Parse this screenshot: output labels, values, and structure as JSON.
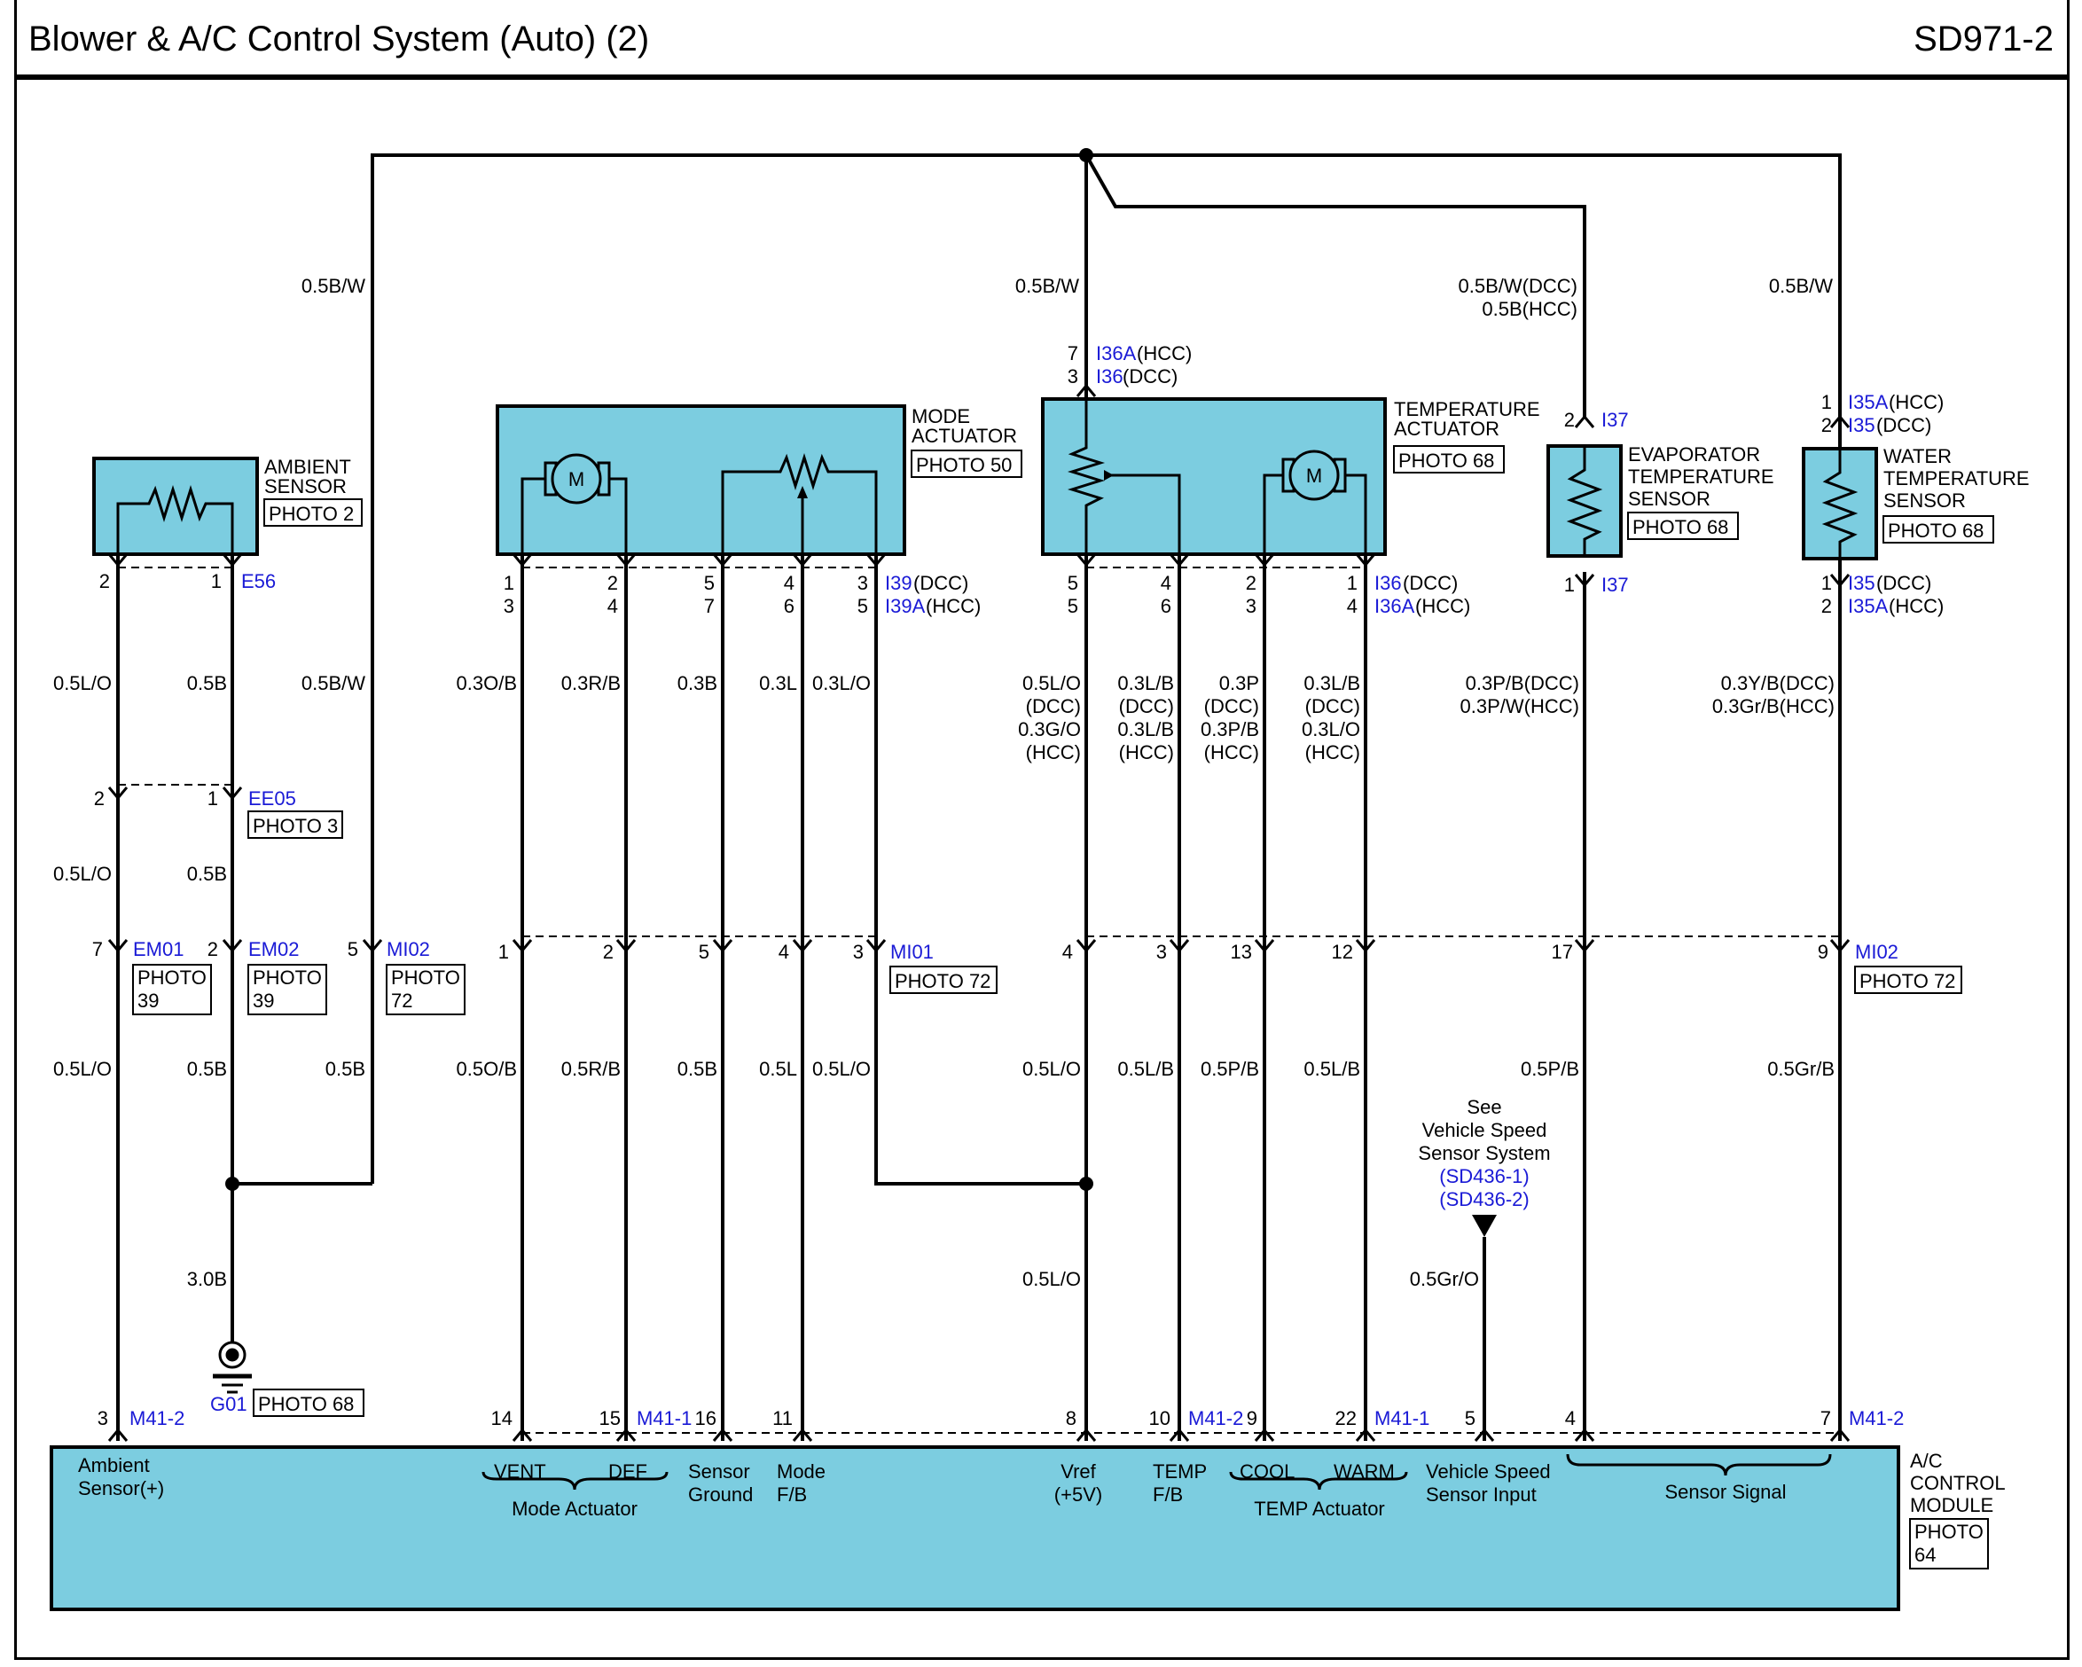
{
  "header": {
    "title": "Blower & A/C Control System (Auto) (2)",
    "code": "SD971-2"
  },
  "colors": {
    "component_fill": "#7ccde0",
    "connector_text": "#1a1ad6",
    "wire": "#000000"
  },
  "components": {
    "ambient_sensor": {
      "name": [
        "AMBIENT",
        "SENSOR"
      ],
      "photo": "PHOTO 2"
    },
    "mode_actuator": {
      "name": [
        "MODE",
        "ACTUATOR"
      ],
      "photo": "PHOTO 50"
    },
    "temperature_actuator": {
      "name": [
        "TEMPERATURE",
        "ACTUATOR"
      ],
      "photo": "PHOTO 68"
    },
    "evaporator_sensor": {
      "name": [
        "EVAPORATOR",
        "TEMPERATURE",
        "SENSOR"
      ],
      "photo": "PHOTO 68"
    },
    "water_sensor": {
      "name": [
        "WATER",
        "TEMPERATURE",
        "SENSOR"
      ],
      "photo": "PHOTO 68"
    },
    "control_module": {
      "name": [
        "A/C",
        "CONTROL",
        "MODULE"
      ],
      "photo": [
        "PHOTO",
        "64"
      ]
    }
  },
  "connectors": {
    "e56": "E56",
    "ee05": "EE05",
    "ee05_photo": "PHOTO 3",
    "em01": "EM01",
    "em01_photo": [
      "PHOTO",
      "39"
    ],
    "em02": "EM02",
    "em02_photo": [
      "PHOTO",
      "39"
    ],
    "mi02_left": "MI02",
    "mi02_left_photo": [
      "PHOTO",
      "72"
    ],
    "mi01": "MI01",
    "mi01_photo": "PHOTO 72",
    "mi02_right": "MI02",
    "mi02_right_photo": "PHOTO 72",
    "i39": "I39",
    "i39_suffix": "(DCC)",
    "i39a": "I39A",
    "i39a_suffix": "(HCC)",
    "i36a_top": "I36A",
    "i36a_top_suffix": "(HCC)",
    "i36_top": "I36",
    "i36_top_suffix": "(DCC)",
    "i36_bot": "I36",
    "i36_bot_suffix": "(DCC)",
    "i36a_bot": "I36A",
    "i36a_bot_suffix": "(HCC)",
    "i37_top": "I37",
    "i37_bot": "I37",
    "i35a_top": "I35A",
    "i35a_top_suffix": "(HCC)",
    "i35_top": "I35",
    "i35_top_suffix": "(DCC)",
    "i35_bot": "I35",
    "i35_bot_suffix": "(DCC)",
    "i35a_bot": "I35A",
    "i35a_bot_suffix": "(HCC)",
    "m41_2_left": "M41-2",
    "m41_1_left": "M41-1",
    "m41_2_mid": "M41-2",
    "m41_1_right": "M41-1",
    "m41_2_right": "M41-2",
    "g01": "G01",
    "g01_photo": "PHOTO 68"
  },
  "pins": {
    "ambient_top": [
      "2",
      "1"
    ],
    "ee05": [
      "2",
      "1"
    ],
    "em01": "7",
    "em02": "2",
    "mi02_left": "5",
    "mode_top_a": [
      "1",
      "2",
      "5",
      "4",
      "3"
    ],
    "mode_top_b": [
      "3",
      "4",
      "7",
      "6",
      "5"
    ],
    "mi01": [
      "1",
      "2",
      "5",
      "4",
      "3"
    ],
    "temp_top": [
      "7",
      "3"
    ],
    "temp_bot_a": [
      "5",
      "4",
      "2",
      "1"
    ],
    "temp_bot_b": [
      "5",
      "6",
      "3",
      "4"
    ],
    "evap_top": "2",
    "evap_bot": "1",
    "water_top": [
      "1",
      "2"
    ],
    "water_bot": [
      "1",
      "2"
    ],
    "mi02_right": [
      "4",
      "3",
      "13",
      "12",
      "17",
      "9"
    ],
    "module": [
      "3",
      "14",
      "15",
      "16",
      "11",
      "8",
      "10",
      "9",
      "22",
      "5",
      "4",
      "7"
    ]
  },
  "wires": {
    "top_left": "0.5B/W",
    "top_temp": "0.5B/W",
    "top_evap": [
      "0.5B/W(DCC)",
      "0.5B(HCC)"
    ],
    "top_water": "0.5B/W",
    "amb_a": "0.5L/O",
    "amb_b": "0.5B",
    "amb_c": "0.5B/W",
    "amb_a2": "0.5L/O",
    "amb_b2": "0.5B",
    "amb_a3": "0.5L/O",
    "amb_b3": "0.5B",
    "amb_c3": "0.5B",
    "ground": "3.0B",
    "mode_1": [
      "0.3O/B",
      "0.3R/B",
      "0.3B",
      "0.3L",
      "0.3L/O"
    ],
    "mode_2": [
      "0.5O/B",
      "0.5R/B",
      "0.5B",
      "0.5L",
      "0.5L/O"
    ],
    "temp_1a": [
      "0.5L/O",
      "(DCC)",
      "0.3G/O",
      "(HCC)"
    ],
    "temp_1b": [
      "0.3L/B",
      "(DCC)",
      "0.3L/B",
      "(HCC)"
    ],
    "temp_1c": [
      "0.3P",
      "(DCC)",
      "0.3P/B",
      "(HCC)"
    ],
    "temp_1d": [
      "0.3L/B",
      "(DCC)",
      "0.3L/O",
      "(HCC)"
    ],
    "temp_2": [
      "0.5L/O",
      "0.5L/B",
      "0.5P/B",
      "0.5L/B"
    ],
    "vref_low": "0.5L/O",
    "evap_1": [
      "0.3P/B(DCC)",
      "0.3P/W(HCC)"
    ],
    "evap_2": "0.5P/B",
    "water_1": [
      "0.3Y/B(DCC)",
      "0.3Gr/B(HCC)"
    ],
    "water_2": "0.5Gr/B",
    "vss": "0.5Gr/O"
  },
  "reference": {
    "lines": [
      "See",
      "Vehicle Speed",
      "Sensor System"
    ],
    "links": [
      "(SD436-1)",
      "(SD436-2)"
    ]
  },
  "module_labels": {
    "ambient": [
      "Ambient",
      "Sensor(+)"
    ],
    "vent": "VENT",
    "def": "DEF",
    "mode_actuator": "Mode Actuator",
    "sensor_ground": [
      "Sensor",
      "Ground"
    ],
    "mode_fb": [
      "Mode",
      "F/B"
    ],
    "vref": [
      "Vref",
      "(+5V)"
    ],
    "temp_fb": [
      "TEMP",
      "F/B"
    ],
    "cool": "COOL",
    "warm": "WARM",
    "temp_actuator": "TEMP Actuator",
    "vss_input": [
      "Vehicle Speed",
      "Sensor Input"
    ],
    "sensor_signal": "Sensor Signal"
  },
  "motor_symbol": "M"
}
